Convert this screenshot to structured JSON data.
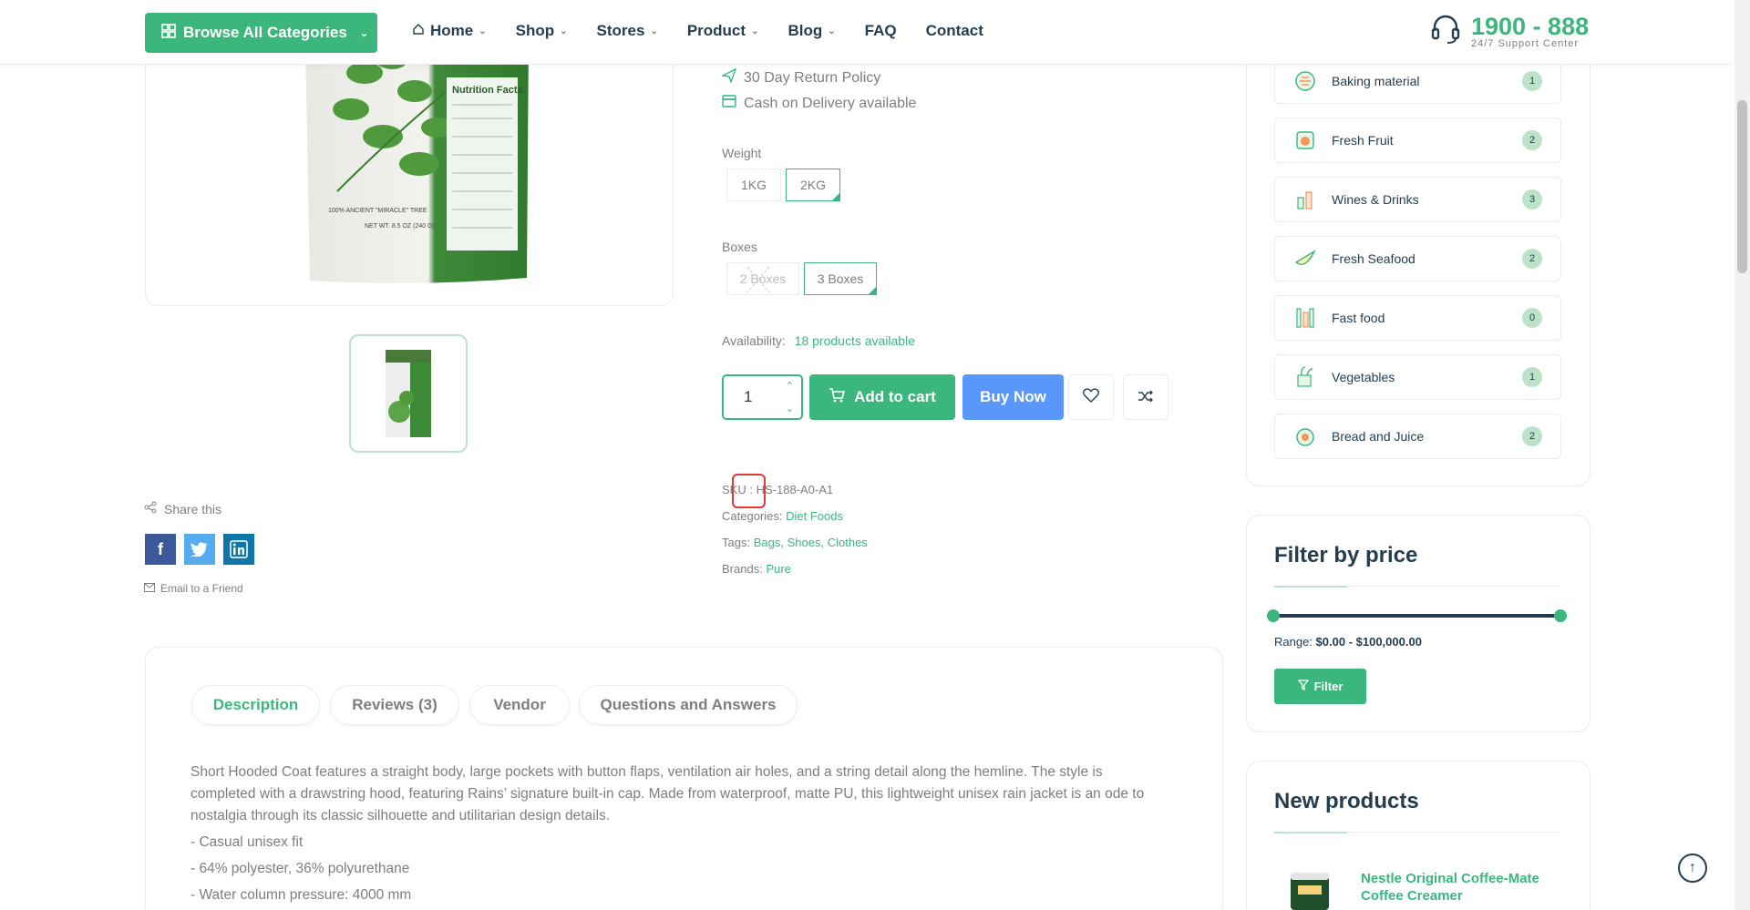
{
  "header": {
    "browse_label": "Browse All Categories",
    "nav": [
      "Home",
      "Shop",
      "Stores",
      "Product",
      "Blog",
      "FAQ",
      "Contact"
    ],
    "support_number": "1900 - 888",
    "support_sub": "24/7 Support Center"
  },
  "product": {
    "policies": [
      "30 Day Return Policy",
      "Cash on Delivery available"
    ],
    "weight_label": "Weight",
    "weights": [
      "1KG",
      "2KG"
    ],
    "boxes_label": "Boxes",
    "boxes": [
      "2 Boxes",
      "3 Boxes"
    ],
    "availability_label": "Availability:",
    "availability_value": "18 products available",
    "quantity": "1",
    "add_to_cart": "Add to cart",
    "buy_now": "Buy Now",
    "sku_label": "SKU :",
    "sku_value": "HS-188-A0-A1",
    "categories_label": "Categories:",
    "categories_value": "Diet Foods",
    "tags_label": "Tags:",
    "tags": [
      "Bags",
      "Shoes",
      "Clothes"
    ],
    "brands_label": "Brands:",
    "brands_value": "Pure",
    "share_label": "Share this",
    "email_friend": "Email to a Friend"
  },
  "tabs": [
    "Description",
    "Reviews (3)",
    "Vendor",
    "Questions and Answers"
  ],
  "description": {
    "paragraph": "Short Hooded Coat features a straight body, large pockets with button flaps, ventilation air holes, and a string detail along the hemline. The style is completed with a drawstring hood, featuring Rains’ signature built-in cap. Made from waterproof, matte PU, this lightweight unisex rain jacket is an ode to nostalgia through its classic silhouette and utilitarian design details.",
    "bullets": [
      "- Casual unisex fit",
      "- 64% polyester, 36% polyurethane",
      "- Water column pressure: 4000 mm"
    ]
  },
  "categories": [
    {
      "name": "Baking material",
      "count": "1"
    },
    {
      "name": "Fresh Fruit",
      "count": "2"
    },
    {
      "name": "Wines & Drinks",
      "count": "3"
    },
    {
      "name": "Fresh Seafood",
      "count": "2"
    },
    {
      "name": "Fast food",
      "count": "0"
    },
    {
      "name": "Vegetables",
      "count": "1"
    },
    {
      "name": "Bread and Juice",
      "count": "2"
    }
  ],
  "filter": {
    "title": "Filter by price",
    "range_label": "Range:",
    "range_value": "$0.00 - $100,000.00",
    "button": "Filter"
  },
  "new_products": {
    "title": "New products",
    "first_name": "Nestle Original Coffee-Mate Coffee Creamer"
  },
  "colors": {
    "brand": "#3bb77e",
    "buy_now": "#5a97fa",
    "dark": "#253d4e",
    "facebook": "#3b5998",
    "twitter": "#55acee",
    "linkedin": "#0e76a8"
  }
}
